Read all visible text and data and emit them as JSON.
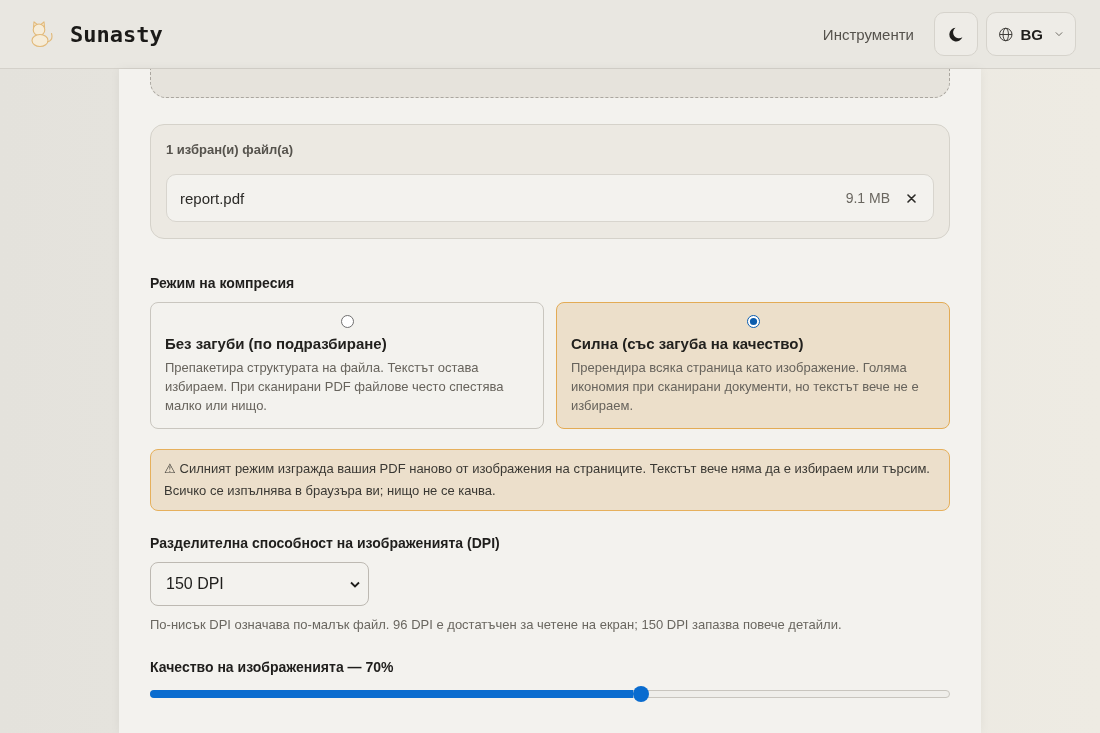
{
  "header": {
    "brand": "Sunasty",
    "nav_link": "Инструменти",
    "language": "BG"
  },
  "selected_files": {
    "title": "1 избран(и) файл(а)",
    "files": [
      {
        "name": "report.pdf",
        "size": "9.1 MB"
      }
    ]
  },
  "compression": {
    "label": "Режим на компресия",
    "options": [
      {
        "title": "Без загуби (по подразбиране)",
        "description": "Препакетира структурата на файла. Текстът остава избираем. При сканирани PDF файлове често спестява малко или нищо.",
        "selected": false
      },
      {
        "title": "Силна (със загуба на качество)",
        "description": "Пререндира всяка страница като изображение. Голяма икономия при сканирани документи, но текстът вече не е избираем.",
        "selected": true
      }
    ]
  },
  "warning": {
    "text": "⚠ Силният режим изгражда вашия PDF наново от изображения на страниците. Текстът вече няма да е избираем или търсим. Всичко се изпълнява в браузъра ви; нищо не се качва."
  },
  "resolution": {
    "label": "Разделителна способност на изображенията (DPI)",
    "value": "150 DPI",
    "hint": "По-нисък DPI означава по-малък файл. 96 DPI е достатъчен за четене на екран; 150 DPI запазва повече детайли."
  },
  "quality": {
    "label": "Качество на изображенията — 70%",
    "level": 0.614
  }
}
